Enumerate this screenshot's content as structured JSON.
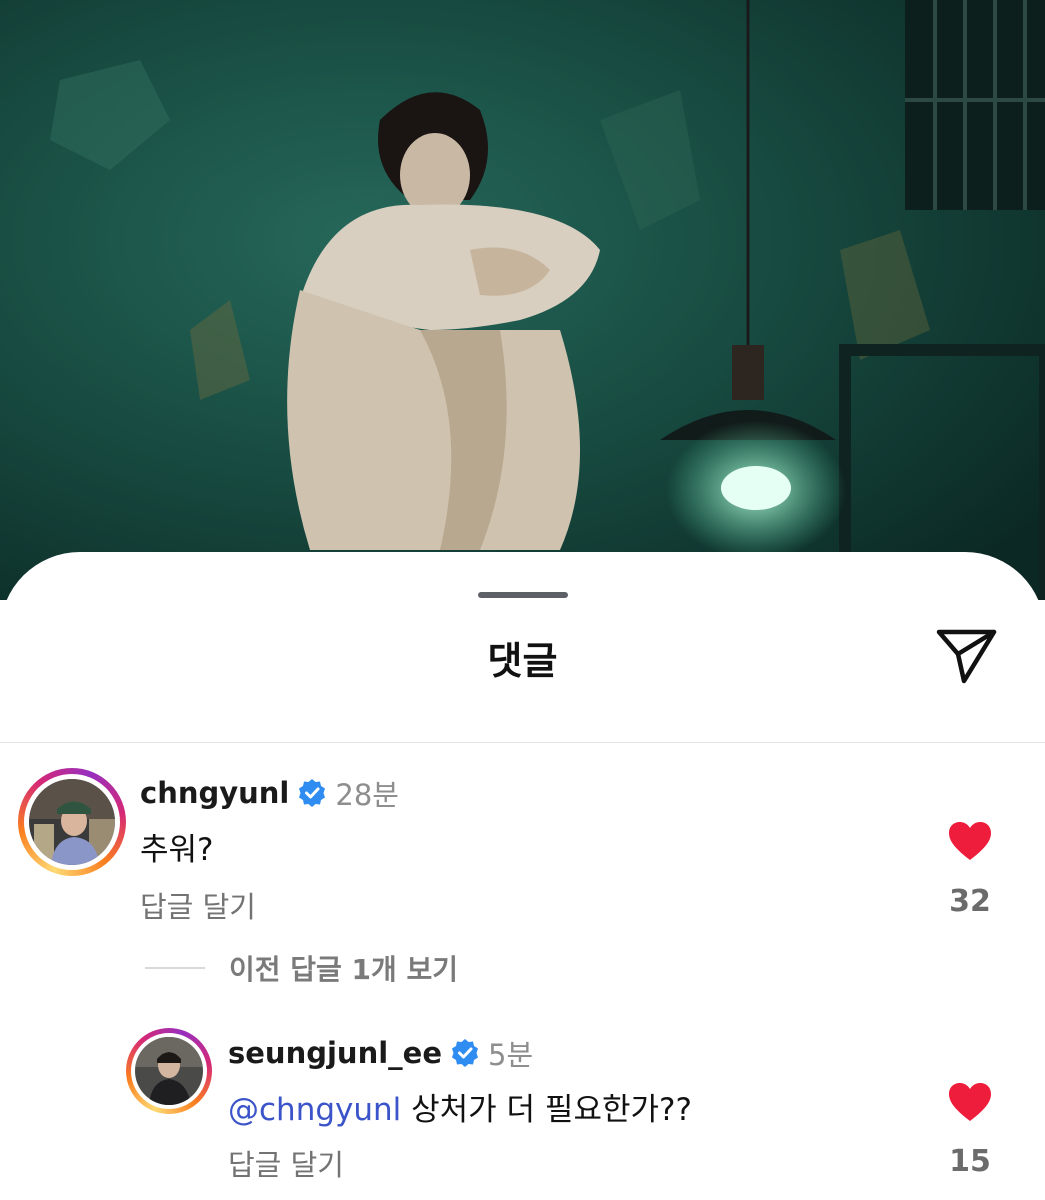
{
  "sheet": {
    "title": "댓글",
    "icons": {
      "share": "paper-plane-icon",
      "verified": "verified-badge-icon",
      "like": "heart-icon"
    },
    "colors": {
      "heart": "#ee1d3b",
      "mention": "#3b54c9",
      "verified": "#2f8cf0"
    }
  },
  "comments": [
    {
      "username": "chngyunl",
      "time": "28분",
      "text": "추워?",
      "reply_label": "답글 달기",
      "likes": "32",
      "liked": true,
      "view_replies": "이전 답글 1개 보기"
    }
  ],
  "replies": [
    {
      "username": "seungjunl_ee",
      "time": "5분",
      "mention": "@chngyunl",
      "text": "상처가 더 필요한가??",
      "reply_label": "답글 달기",
      "likes": "15",
      "liked": true
    }
  ]
}
